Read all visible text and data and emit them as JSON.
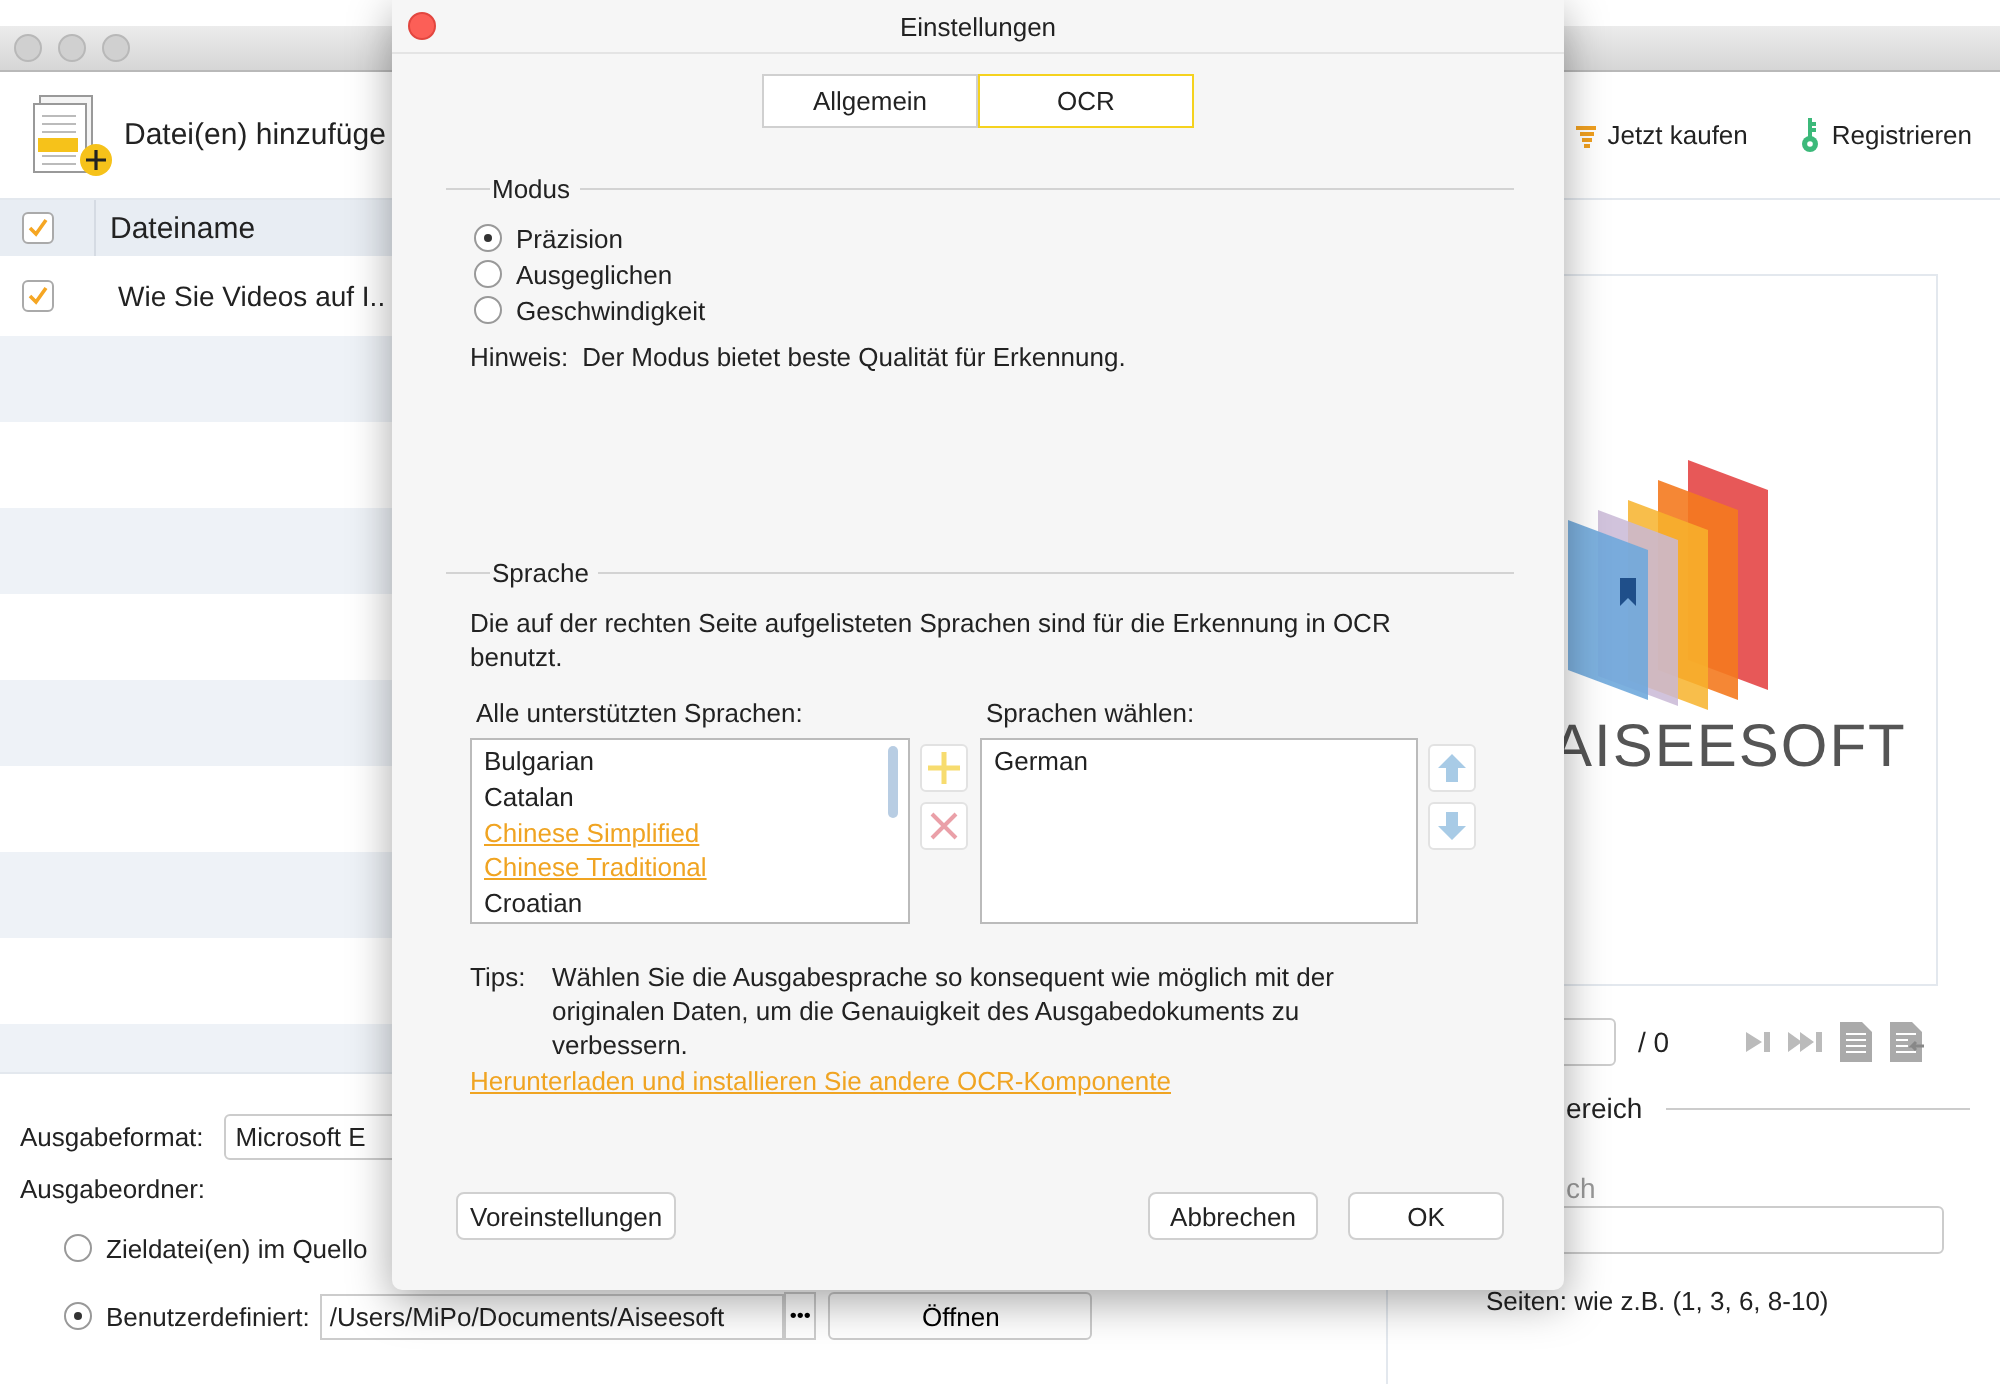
{
  "app": {
    "toolbar": {
      "add_files": "Datei(en) hinzufüge",
      "buy": "Jetzt kaufen",
      "register": "Registrieren"
    },
    "file_table": {
      "header": {
        "checked": true,
        "label": "Dateiname"
      },
      "rows": [
        {
          "checked": true,
          "name": "Wie Sie Videos auf I.."
        }
      ]
    },
    "output": {
      "format_label": "Ausgabeformat:",
      "format_value": "Microsoft E",
      "folder_label": "Ausgabeordner:",
      "options": [
        {
          "label": "Zieldatei(en) im Quello",
          "selected": false
        },
        {
          "label": "Benutzerdefiniert:",
          "selected": true
        }
      ],
      "path": "/Users/MiPo/Documents/Aiseesoft",
      "browse": "•••",
      "open": "Öffnen"
    },
    "preview": {
      "logo_text": "AISEESOFT",
      "page_total": "/ 0",
      "range_heading": "ereich",
      "range_label": "ch",
      "range_hint": "Seiten: wie z.B. (1, 3, 6, 8-10)"
    }
  },
  "dialog": {
    "title": "Einstellungen",
    "tabs": [
      {
        "label": "Allgemein",
        "selected": false
      },
      {
        "label": "OCR",
        "selected": true
      }
    ],
    "mode": {
      "heading": "Modus",
      "options": [
        {
          "label": "Präzision",
          "selected": true
        },
        {
          "label": "Ausgeglichen",
          "selected": false
        },
        {
          "label": "Geschwindigkeit",
          "selected": false
        }
      ],
      "hint_label": "Hinweis:",
      "hint": "Der Modus bietet beste Qualität für Erkennung."
    },
    "language": {
      "heading": "Sprache",
      "description": "Die auf der rechten Seite aufgelisteten Sprachen sind für die Erkennung in OCR benutzt.",
      "available_label": "Alle unterstützten Sprachen:",
      "available": [
        {
          "name": "Bulgarian",
          "highlighted": false
        },
        {
          "name": "Catalan",
          "highlighted": false
        },
        {
          "name": "Chinese Simplified",
          "highlighted": true
        },
        {
          "name": "Chinese Traditional",
          "highlighted": true
        },
        {
          "name": "Croatian",
          "highlighted": false
        }
      ],
      "chosen_label": "Sprachen wählen:",
      "chosen": [
        "German"
      ]
    },
    "tips_label": "Tips:",
    "tips": "Wählen Sie die Ausgabesprache so konsequent wie möglich mit der originalen Daten, um die Genauigkeit des Ausgabedokuments zu verbessern.",
    "download_link": "Herunterladen und installieren Sie andere OCR-Komponente",
    "buttons": {
      "defaults": "Voreinstellungen",
      "cancel": "Abbrechen",
      "ok": "OK"
    }
  }
}
